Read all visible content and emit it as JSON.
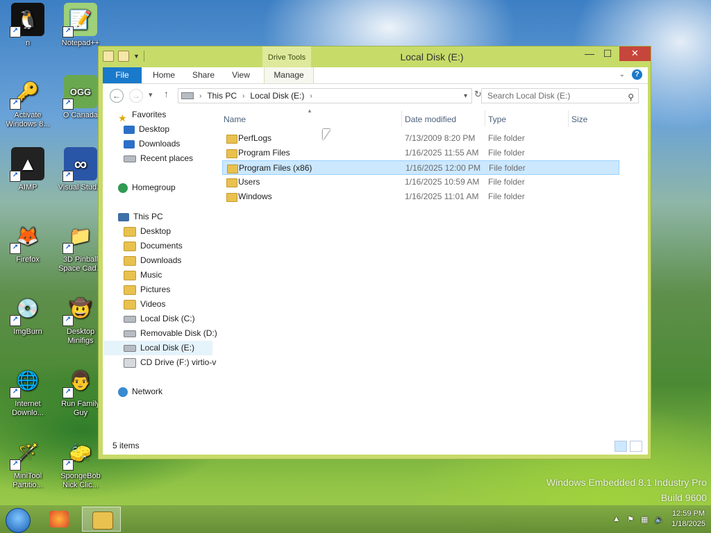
{
  "desktop": {
    "icons": [
      {
        "label": "n",
        "glyph": "🐧",
        "bg": "#111"
      },
      {
        "label": "Notepad++",
        "glyph": "📝",
        "bg": "#9fd07a"
      },
      {
        "label": "Activate Windows 8...",
        "glyph": "🔑",
        "bg": "transparent"
      },
      {
        "label": "O Canada",
        "glyph": "OGG",
        "bg": "#6aa84f"
      },
      {
        "label": "AIMP",
        "glyph": "▲",
        "bg": "#222"
      },
      {
        "label": "Visual Stud...",
        "glyph": "∞",
        "bg": "#2a56a8"
      },
      {
        "label": "Firefox",
        "glyph": "🦊",
        "bg": "transparent"
      },
      {
        "label": "3D Pinball Space Cad...",
        "glyph": "📁",
        "bg": "transparent"
      },
      {
        "label": "ImgBurn",
        "glyph": "💿",
        "bg": "transparent"
      },
      {
        "label": "Desktop Minifigs",
        "glyph": "🤠",
        "bg": "transparent"
      },
      {
        "label": "Internet Downlo...",
        "glyph": "🌐",
        "bg": "transparent"
      },
      {
        "label": "Run Family Guy",
        "glyph": "👨",
        "bg": "transparent"
      },
      {
        "label": "MiniTool Partitio...",
        "glyph": "🪄",
        "bg": "transparent"
      },
      {
        "label": "SpongeBob Nick Clic...",
        "glyph": "🧽",
        "bg": "transparent"
      }
    ]
  },
  "window": {
    "title": "Local Disk (E:)",
    "context_tab": "Drive Tools",
    "controls": {
      "minimize": "—",
      "maximize": "☐",
      "close": "✕"
    },
    "ribbon_tabs": [
      "File",
      "Home",
      "Share",
      "View",
      "Manage"
    ],
    "help": "?",
    "address": {
      "segments": [
        "This PC",
        "Local Disk (E:)"
      ]
    },
    "search_placeholder": "Search Local Disk (E:)",
    "nav": {
      "favorites": {
        "label": "Favorites",
        "items": [
          "Desktop",
          "Downloads",
          "Recent places"
        ]
      },
      "homegroup": "Homegroup",
      "this_pc": {
        "label": "This PC",
        "items": [
          "Desktop",
          "Documents",
          "Downloads",
          "Music",
          "Pictures",
          "Videos",
          "Local Disk (C:)",
          "Removable Disk (D:)",
          "Local Disk (E:)",
          "CD Drive (F:) virtio-v"
        ]
      },
      "network": "Network"
    },
    "columns": {
      "name": "Name",
      "date": "Date modified",
      "type": "Type",
      "size": "Size"
    },
    "files": [
      {
        "name": "PerfLogs",
        "date": "7/13/2009 8:20 PM",
        "type": "File folder"
      },
      {
        "name": "Program Files",
        "date": "1/16/2025 11:55 AM",
        "type": "File folder"
      },
      {
        "name": "Program Files (x86)",
        "date": "1/16/2025 12:00 PM",
        "type": "File folder"
      },
      {
        "name": "Users",
        "date": "1/16/2025 10:59 AM",
        "type": "File folder"
      },
      {
        "name": "Windows",
        "date": "1/16/2025 11:01 AM",
        "type": "File folder"
      }
    ],
    "selected_file": "Program Files (x86)",
    "selected_nav": "Local Disk (E:)",
    "status": "5 items"
  },
  "branding": {
    "line1": "Windows Embedded 8.1 Industry Pro",
    "line2": "Build 9600"
  },
  "taskbar": {
    "time": "12:59 PM",
    "date": "1/18/2025"
  },
  "colors": {
    "window_frame": "#c7db69",
    "file_tab": "#1979ca",
    "selection": "#cce8ff",
    "close": "#c7463c"
  }
}
